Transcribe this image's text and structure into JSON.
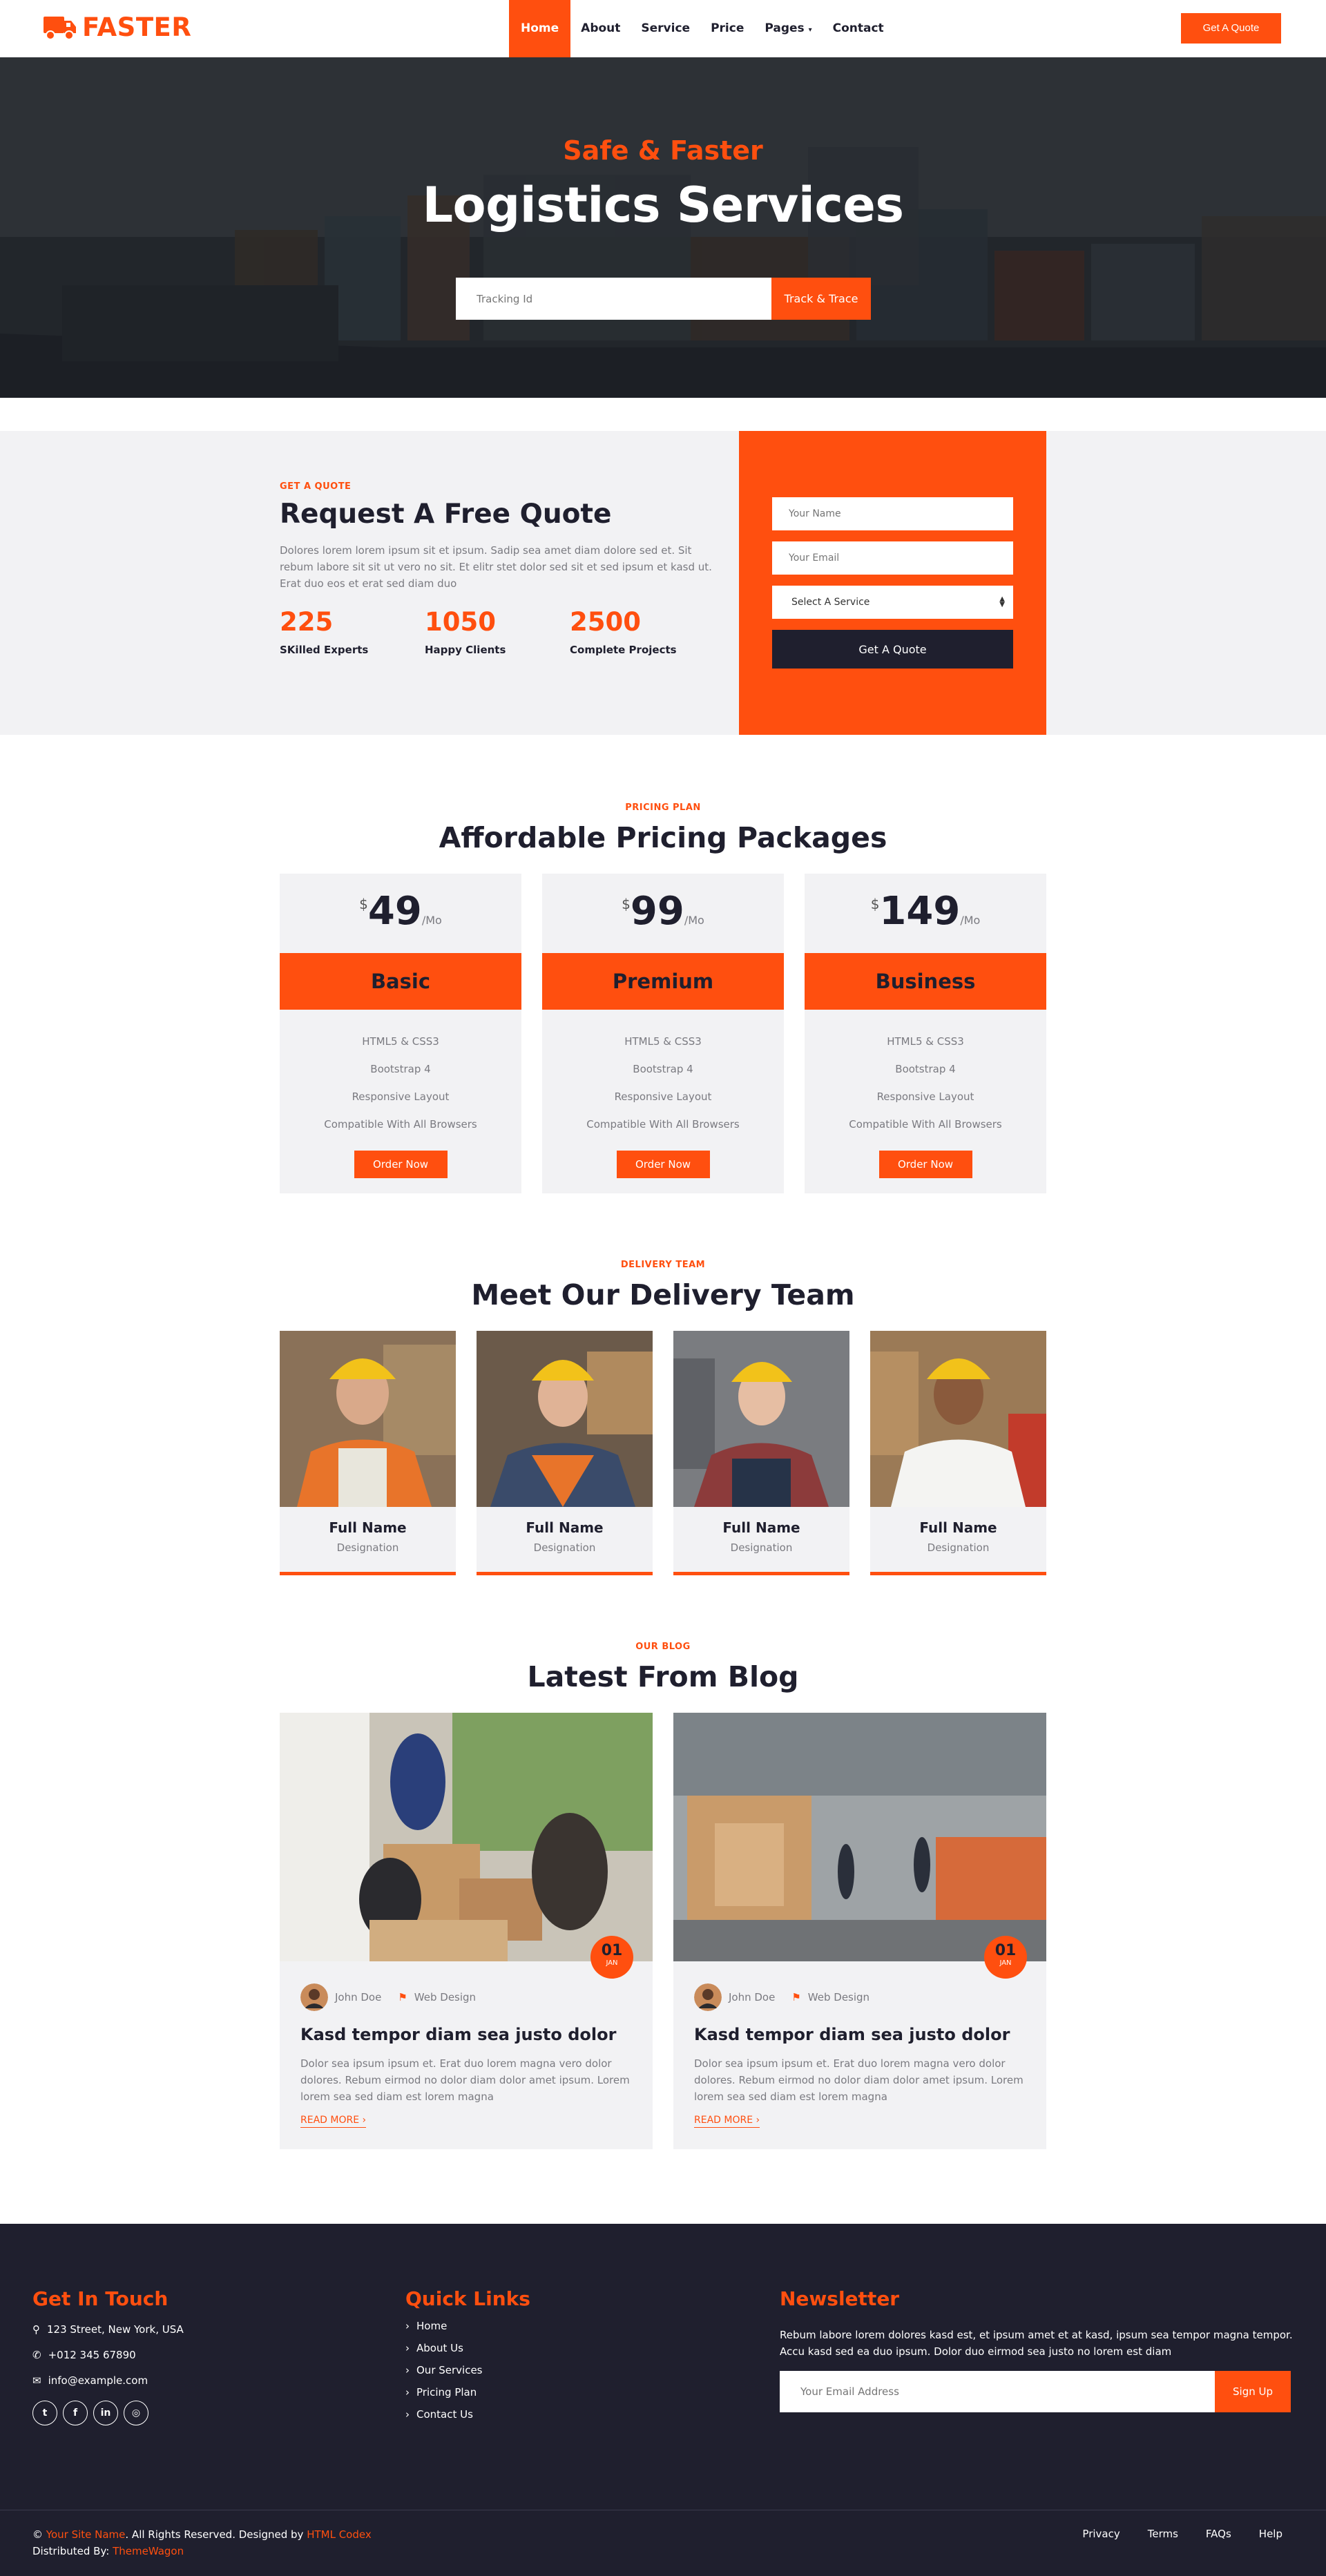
{
  "brand": {
    "name": "FASTER"
  },
  "nav": {
    "items": [
      {
        "label": "Home",
        "active": true
      },
      {
        "label": "About"
      },
      {
        "label": "Service"
      },
      {
        "label": "Price"
      },
      {
        "label": "Pages"
      },
      {
        "label": "Contact"
      }
    ],
    "cta": "Get A Quote"
  },
  "hero": {
    "subtitle": "Safe & Faster",
    "title": "Logistics Services",
    "input_placeholder": "Tracking Id",
    "button": "Track & Trace"
  },
  "quote": {
    "eyebrow": "Get A Quote",
    "title": "Request A Free Quote",
    "text": "Dolores lorem lorem ipsum sit et ipsum. Sadip sea amet diam dolore sed et. Sit rebum labore sit sit ut vero no sit. Et elitr stet dolor sed sit et sed ipsum et kasd ut. Erat duo eos et erat sed diam duo",
    "stats": [
      {
        "value": "225",
        "label": "SKilled Experts"
      },
      {
        "value": "1050",
        "label": "Happy Clients"
      },
      {
        "value": "2500",
        "label": "Complete Projects"
      }
    ],
    "form": {
      "name_placeholder": "Your Name",
      "email_placeholder": "Your Email",
      "service_selected": "Select A Service",
      "button": "Get A Quote"
    }
  },
  "pricing": {
    "eyebrow": "Pricing Plan",
    "title": "Affordable Pricing Packages",
    "currency": "$",
    "period": "/Mo",
    "plans": [
      {
        "price": "49",
        "name": "Basic",
        "features": [
          "HTML5 & CSS3",
          "Bootstrap 4",
          "Responsive Layout",
          "Compatible With All Browsers"
        ],
        "button": "Order Now"
      },
      {
        "price": "99",
        "name": "Premium",
        "features": [
          "HTML5 & CSS3",
          "Bootstrap 4",
          "Responsive Layout",
          "Compatible With All Browsers"
        ],
        "button": "Order Now"
      },
      {
        "price": "149",
        "name": "Business",
        "features": [
          "HTML5 & CSS3",
          "Bootstrap 4",
          "Responsive Layout",
          "Compatible With All Browsers"
        ],
        "button": "Order Now"
      }
    ]
  },
  "team": {
    "eyebrow": "Delivery Team",
    "title": "Meet Our Delivery Team",
    "members": [
      {
        "name": "Full Name",
        "role": "Designation"
      },
      {
        "name": "Full Name",
        "role": "Designation"
      },
      {
        "name": "Full Name",
        "role": "Designation"
      },
      {
        "name": "Full Name",
        "role": "Designation"
      }
    ]
  },
  "blog": {
    "eyebrow": "Our Blog",
    "title": "Latest From Blog",
    "posts": [
      {
        "day": "01",
        "month": "JAN",
        "author": "John Doe",
        "category": "Web Design",
        "title": "Kasd tempor diam sea justo dolor",
        "text": "Dolor sea ipsum ipsum et. Erat duo lorem magna vero dolor dolores. Rebum eirmod no dolor diam dolor amet ipsum. Lorem lorem sea sed diam est lorem magna",
        "link": "READ MORE"
      },
      {
        "day": "01",
        "month": "JAN",
        "author": "John Doe",
        "category": "Web Design",
        "title": "Kasd tempor diam sea justo dolor",
        "text": "Dolor sea ipsum ipsum et. Erat duo lorem magna vero dolor dolores. Rebum eirmod no dolor diam dolor amet ipsum. Lorem lorem sea sed diam est lorem magna",
        "link": "READ MORE"
      }
    ]
  },
  "footer": {
    "contact": {
      "title": "Get In Touch",
      "address": "123 Street, New York, USA",
      "phone": "+012 345 67890",
      "email": "info@example.com"
    },
    "links": {
      "title": "Quick Links",
      "items": [
        "Home",
        "About Us",
        "Our Services",
        "Pricing Plan",
        "Contact Us"
      ]
    },
    "newsletter": {
      "title": "Newsletter",
      "text": "Rebum labore lorem dolores kasd est, et ipsum amet et at kasd, ipsum sea tempor magna tempor. Accu kasd sed ea duo ipsum. Dolor duo eirmod sea justo no lorem est diam",
      "placeholder": "Your Email Address",
      "button": "Sign Up"
    },
    "copyright": {
      "prefix": "© ",
      "site": "Your Site Name",
      "middle": ". All Rights Reserved. Designed by ",
      "designer": "HTML Codex",
      "distributed_prefix": "Distributed By: ",
      "distributor": "ThemeWagon"
    },
    "bottom_links": [
      "Privacy",
      "Terms",
      "FAQs",
      "Help"
    ]
  },
  "colors": {
    "accent": "#ff4f0f",
    "dark": "#1f1f2e",
    "light": "#f2f2f4"
  }
}
